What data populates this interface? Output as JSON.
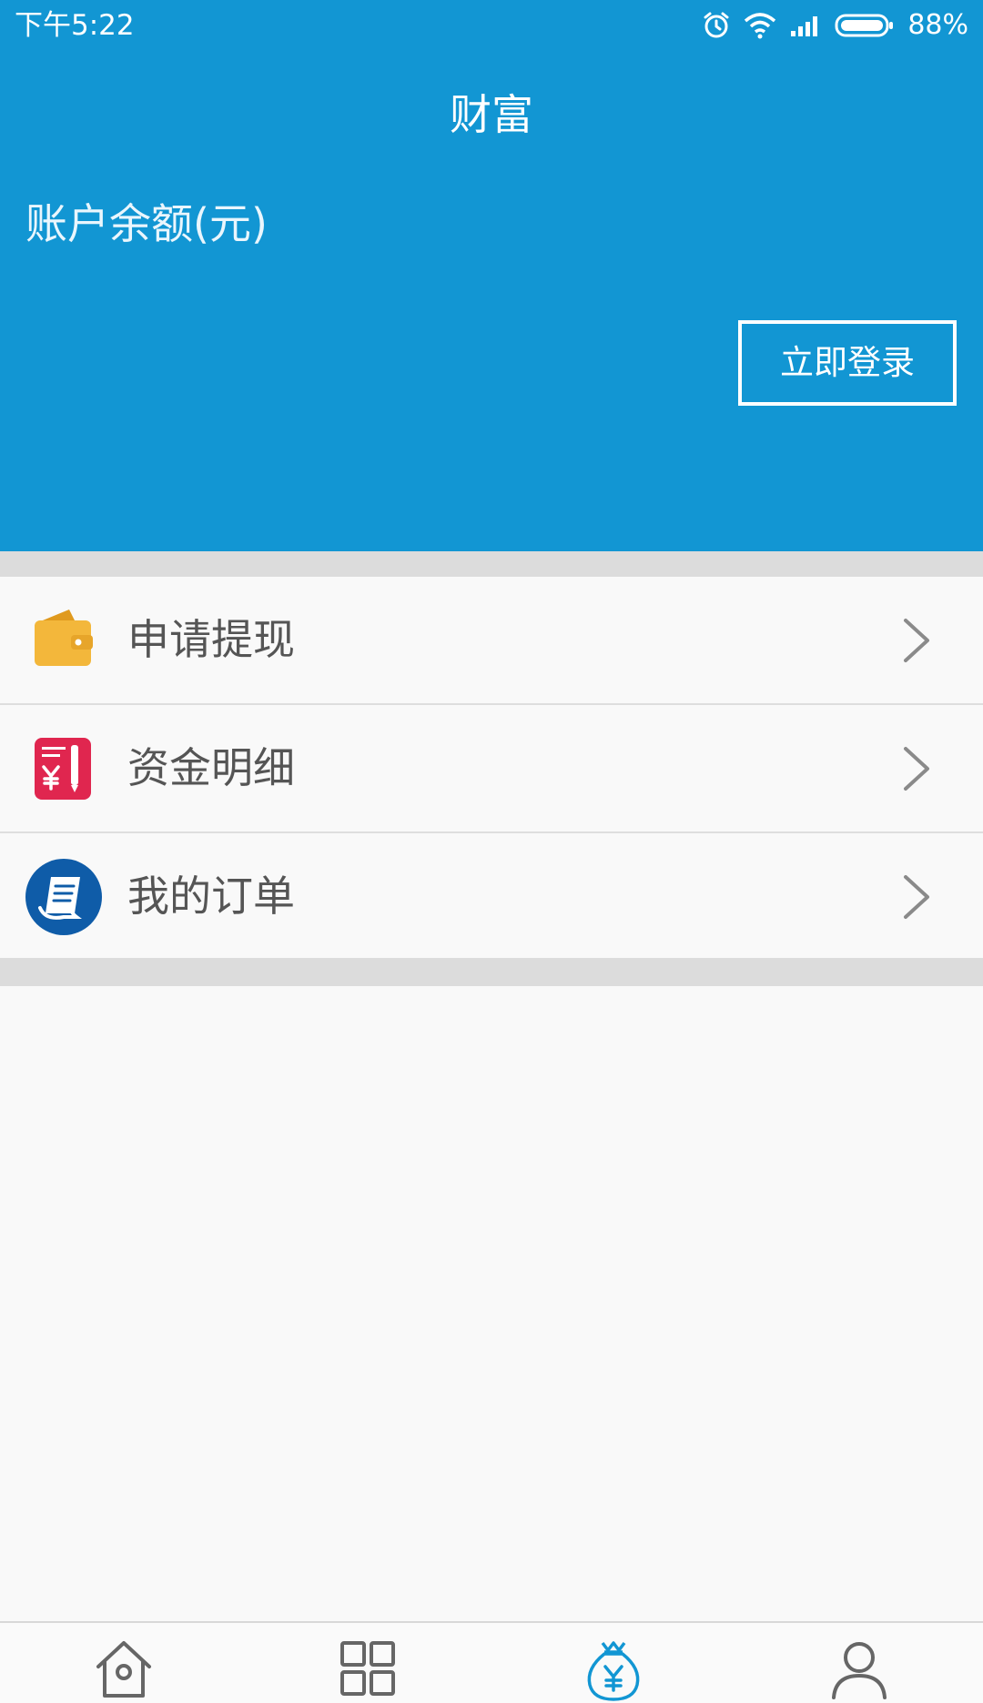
{
  "status_bar": {
    "time": "下午5:22",
    "battery": "88%",
    "icons": [
      "alarm-icon",
      "wifi-icon",
      "signal-icon",
      "battery-icon"
    ]
  },
  "header": {
    "title": "财富",
    "balance_label": "账户余额(元)",
    "login_button": "立即登录",
    "background_color": "#1296d3"
  },
  "menu": {
    "items": [
      {
        "label": "申请提现",
        "icon": "wallet-icon",
        "color": "#f3b73b"
      },
      {
        "label": "资金明细",
        "icon": "ledger-icon",
        "color": "#e0264f"
      },
      {
        "label": "我的订单",
        "icon": "order-icon",
        "color": "#0f5ca8"
      }
    ]
  },
  "tabbar": {
    "tabs": [
      {
        "icon": "home-icon",
        "active": false
      },
      {
        "icon": "grid-icon",
        "active": false
      },
      {
        "icon": "money-bag-icon",
        "active": true
      },
      {
        "icon": "user-icon",
        "active": false
      }
    ],
    "active_color": "#1296d3",
    "inactive_color": "#666666"
  }
}
